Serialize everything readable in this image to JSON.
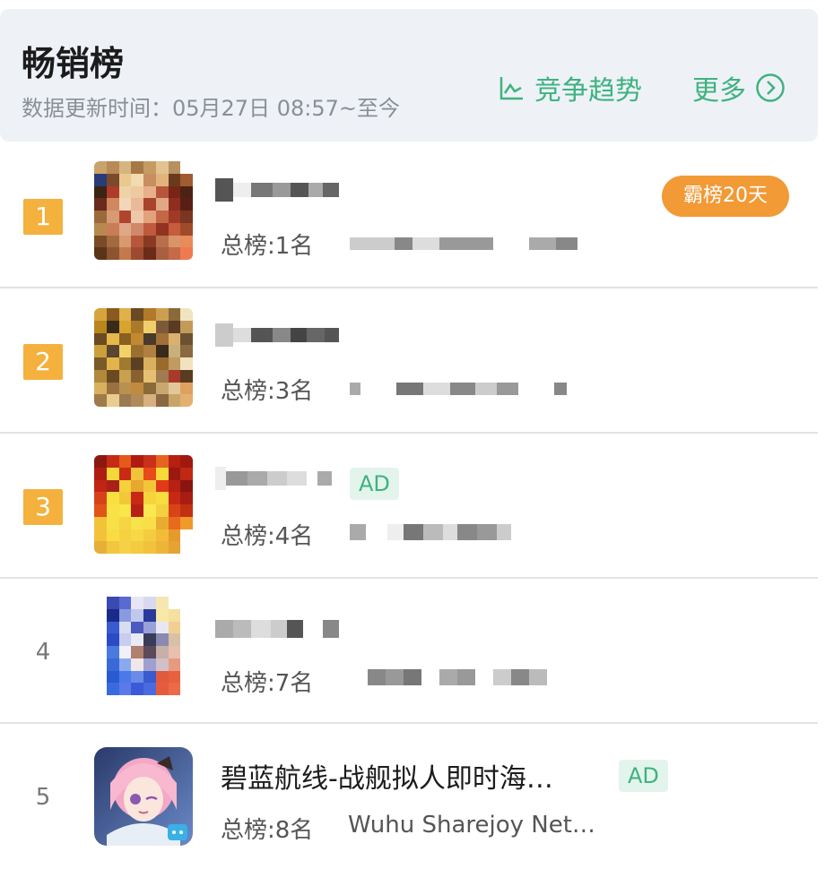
{
  "header": {
    "title": "畅销榜",
    "update_time": "数据更新时间：05月27日 08:57~至今",
    "trend_label": "竞争趋势",
    "more_label": "更多"
  },
  "rows": [
    {
      "rank": "1",
      "overall": "总榜:1名",
      "badge": "霸榜20天"
    },
    {
      "rank": "2",
      "overall": "总榜:3名"
    },
    {
      "rank": "3",
      "overall": "总榜:4名",
      "ad": "AD"
    },
    {
      "rank": "4",
      "overall": "总榜:7名"
    },
    {
      "rank": "5",
      "overall": "总榜:8名",
      "name": "碧蓝航线-战舰拟人即时海…",
      "ad": "AD",
      "developer": "Wuhu Sharejoy Net…"
    }
  ],
  "colors": {
    "accent": "#3fb27f",
    "rank_bg": "#f4b13d",
    "badge_bg": "#f19a36"
  }
}
